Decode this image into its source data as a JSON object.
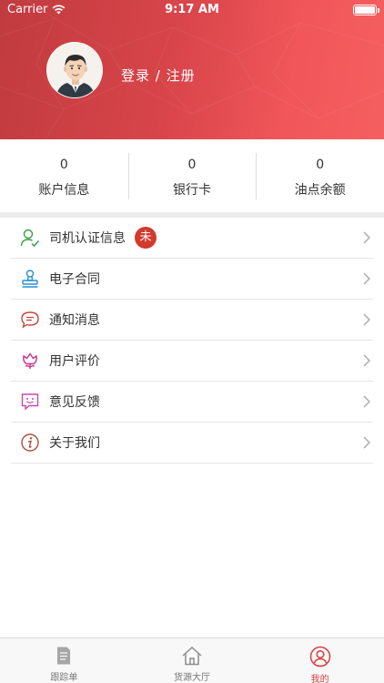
{
  "status_bar": {
    "carrier": "Carrier",
    "time": "9:17 AM",
    "battery_level": 1.0
  },
  "header": {
    "login_register": "登录 / 注册",
    "avatar_icon": "driver-avatar",
    "gradient_colors": [
      "#c03b3f",
      "#f55f60"
    ]
  },
  "stats": [
    {
      "value": "0",
      "label": "账户信息"
    },
    {
      "value": "0",
      "label": "银行卡"
    },
    {
      "value": "0",
      "label": "油点余额"
    }
  ],
  "menu": [
    {
      "label": "司机认证信息",
      "icon": "driver-verify-icon",
      "badge": "未"
    },
    {
      "label": "电子合同",
      "icon": "contract-stamp-icon"
    },
    {
      "label": "通知消息",
      "icon": "message-icon"
    },
    {
      "label": "用户评价",
      "icon": "flower-icon"
    },
    {
      "label": "意见反馈",
      "icon": "feedback-icon"
    },
    {
      "label": "关于我们",
      "icon": "info-icon"
    }
  ],
  "tabbar": {
    "accent_color": "#d83c3c",
    "tabs": [
      {
        "label": "跟踪单",
        "icon": "document-icon",
        "active": false
      },
      {
        "label": "货源大厅",
        "icon": "home-icon",
        "active": false
      },
      {
        "label": "我的",
        "icon": "user-icon",
        "active": true
      }
    ]
  }
}
